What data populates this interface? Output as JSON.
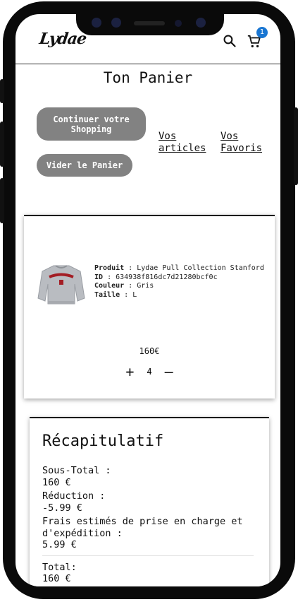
{
  "header": {
    "logo_text": "Lydae",
    "cart_count": "1",
    "search_icon": "search-icon",
    "cart_icon": "shopping-cart-icon"
  },
  "page": {
    "title": "Ton Panier"
  },
  "actions": {
    "continue_label": "Continuer votre Shopping",
    "clear_label": "Vider le Panier",
    "articles_link": "Vos articles",
    "favorites_link": "Vos Favoris"
  },
  "cart_item": {
    "product_label": "Produit",
    "product_value": "Lydae Pull Collection Stanford",
    "id_label": "ID",
    "id_value": "634938f816dc7d21280bcf0c",
    "color_label": "Couleur",
    "color_value": "Gris",
    "size_label": "Taille",
    "size_value": "L",
    "price": "160€",
    "quantity": "4",
    "increment": "+",
    "decrement": "—"
  },
  "summary": {
    "title": "Récapitulatif",
    "subtotal_label": "Sous-Total :",
    "subtotal_value": "160 €",
    "discount_label": "Réduction :",
    "discount_value": "-5.99 €",
    "shipping_label": "Frais estimés de prise en charge et d'expédition :",
    "shipping_value": "5.99 €",
    "total_label": "Total:",
    "total_value": "160 €"
  },
  "colors": {
    "accent": "#1976d2",
    "button_gray": "#828282",
    "frame": "#0a0a0a"
  }
}
